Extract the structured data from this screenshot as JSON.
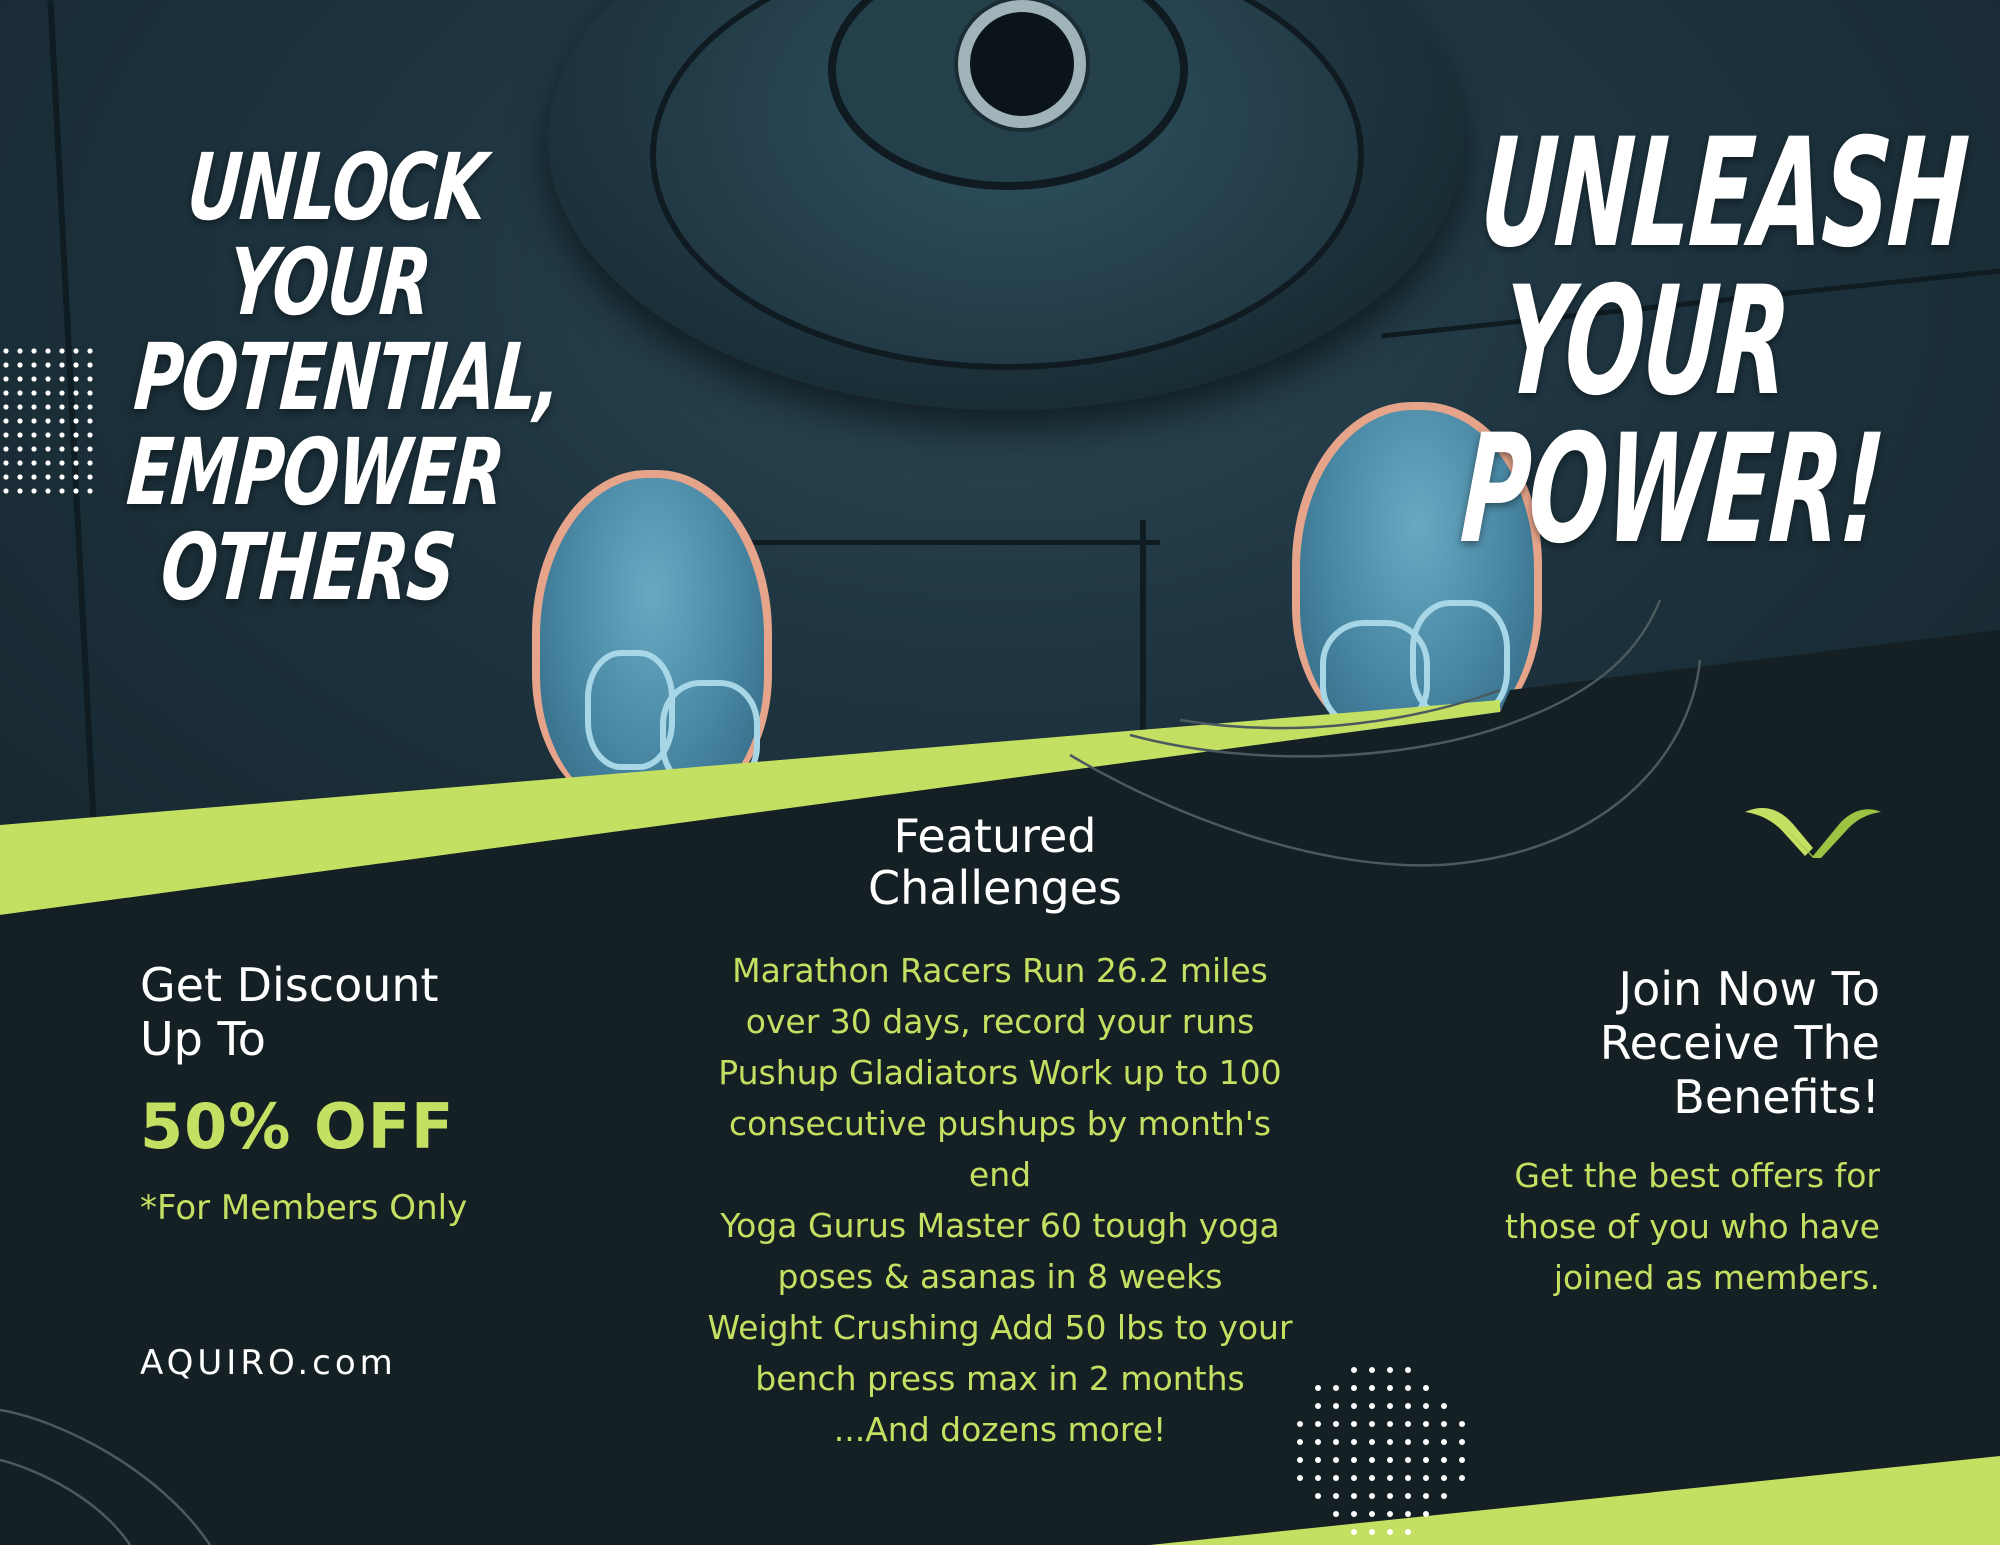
{
  "hero": {
    "headline_left": [
      "UNLOCK",
      "YOUR",
      "POTENTIAL,",
      "EMPOWER",
      "OTHERS"
    ],
    "headline_right": [
      "UNLEASH",
      "YOUR",
      "POWER!"
    ]
  },
  "discount": {
    "heading_line1": "Get Discount",
    "heading_line2": "Up To",
    "value": "50% OFF",
    "note": "*For Members Only"
  },
  "site_url": "AQUIRO.com",
  "featured": {
    "title_line1": "Featured",
    "title_line2": "Challenges",
    "lines": [
      "Marathon Racers Run 26.2 miles",
      "over 30 days, record your runs",
      "Pushup Gladiators Work up to 100",
      "consecutive pushups by month's",
      "end",
      "Yoga Gurus Master 60 tough yoga",
      "poses & asanas in 8 weeks",
      "Weight Crushing Add 50 lbs to your",
      "bench press max in 2 months",
      "...And dozens more!"
    ]
  },
  "join": {
    "heading_line1": "Join Now To",
    "heading_line2": "Receive The",
    "heading_line3": "Benefits!",
    "body_line1": "Get the best offers for",
    "body_line2": "those of you who have",
    "body_line3": "joined as members."
  },
  "colors": {
    "background": "#142023",
    "accent": "#c4e062",
    "text": "#ffffff"
  },
  "icons": {
    "logo": "wave-logo-icon",
    "decor": "dot-grid-icon"
  }
}
